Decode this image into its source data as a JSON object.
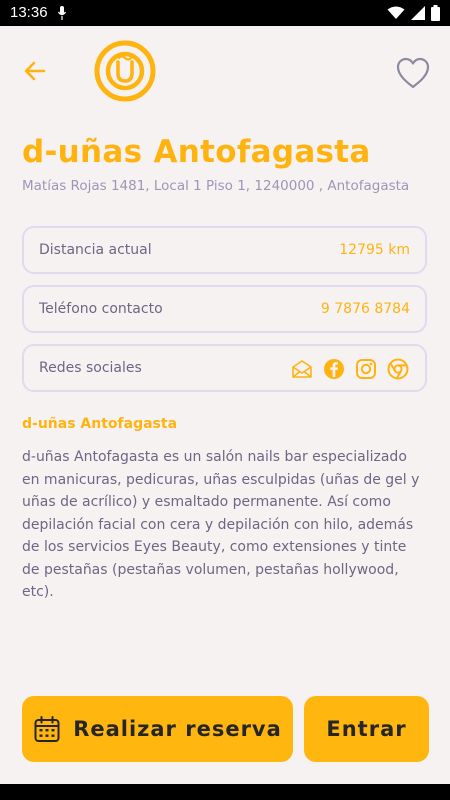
{
  "status_bar": {
    "time": "13:36",
    "icons": [
      "mic-icon",
      "wifi-icon",
      "signal-icon",
      "battery-icon"
    ]
  },
  "header": {
    "back_icon": "arrow-left-icon",
    "logo_icon": "d-unas-logo",
    "favorite_icon": "heart-outline-icon"
  },
  "store": {
    "name": "d-uñas Antofagasta",
    "address": "Matías Rojas 1481, Local 1 Piso 1, 1240000 , Antofagasta"
  },
  "info_rows": {
    "distance": {
      "label": "Distancia actual",
      "value": "12795 km"
    },
    "phone": {
      "label": "Teléfono contacto",
      "value": "9 7876 8784"
    },
    "social": {
      "label": "Redes sociales",
      "icons": [
        "email-icon",
        "facebook-icon",
        "instagram-icon",
        "chrome-icon"
      ]
    }
  },
  "description": {
    "heading": "d-uñas Antofagasta",
    "text": "d-uñas Antofagasta es un salón nails bar especializado en manicuras, pedicuras, uñas esculpidas (uñas de gel y uñas de acrílico) y esmaltado permanente. Así como depilación facial con cera y depilación con hilo, además de los servicios Eyes Beauty, como extensiones y tinte de pestañas (pestañas volumen, pestañas hollywood, etc)."
  },
  "actions": {
    "reserve_label": "Realizar reserva",
    "enter_label": "Entrar"
  },
  "colors": {
    "accent": "#ffb310",
    "button": "#ffb60f",
    "background": "#f7f2f2",
    "border": "#dedbf0",
    "muted_text": "#9a97b8"
  }
}
